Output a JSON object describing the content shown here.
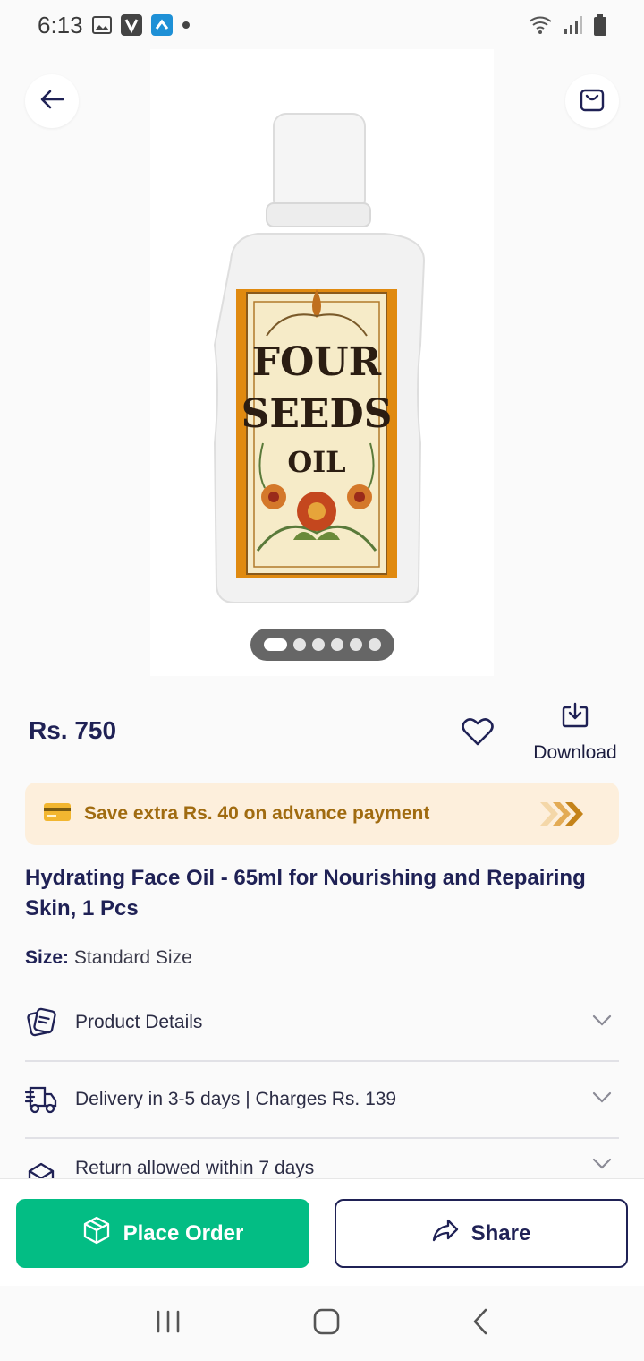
{
  "status_bar": {
    "time": "6:13"
  },
  "product_image": {
    "brand_line1": "FOUR",
    "brand_line2": "SEEDS",
    "brand_line3": "OIL",
    "carousel": {
      "count": 6,
      "active_index": 0
    }
  },
  "price": "Rs. 750",
  "actions": {
    "download_label": "Download"
  },
  "offer": {
    "text": "Save extra Rs. 40 on advance payment"
  },
  "product": {
    "title": "Hydrating Face Oil - 65ml for Nourishing and Repairing Skin, 1 Pcs",
    "size_key": "Size:",
    "size_value": "Standard Size"
  },
  "accordion": [
    {
      "label": "Product Details",
      "icon": "document-icon"
    },
    {
      "label": "Delivery in 3-5 days | Charges Rs. 139",
      "icon": "truck-icon"
    },
    {
      "label": "Return allowed within 7 days",
      "icon": "return-box-icon"
    }
  ],
  "bottom_actions": {
    "place_order": "Place Order",
    "share": "Share"
  },
  "colors": {
    "primary_green": "#03bd84",
    "navy": "#1f2155",
    "offer_bg": "#fdefdc",
    "offer_text": "#a06b10"
  }
}
